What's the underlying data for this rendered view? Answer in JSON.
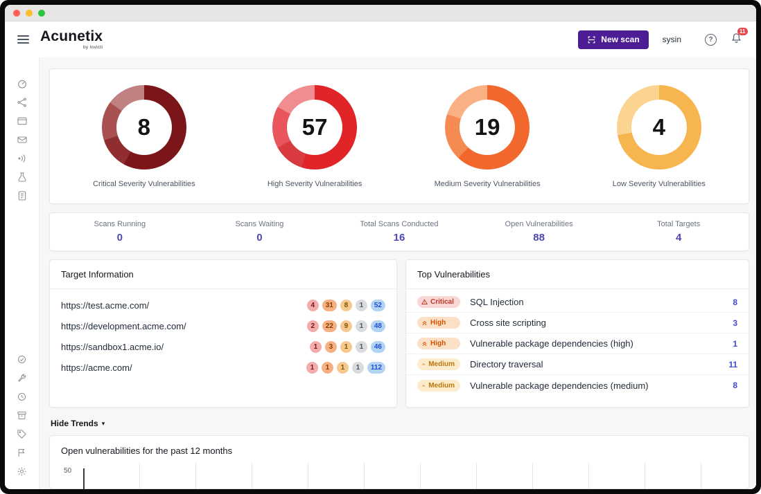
{
  "titlebar": {
    "controls": [
      "close",
      "minimize",
      "zoom"
    ]
  },
  "header": {
    "logo": "Acunetix",
    "logo_sub": "by Invicti",
    "new_scan_label": "New scan",
    "username": "sysin",
    "help_glyph": "?",
    "notification_count": "11"
  },
  "sidebar": {
    "top_icons": [
      "dashboard",
      "discovery",
      "targets",
      "vulnerabilities",
      "scans",
      "labs",
      "reports"
    ],
    "bottom_icons": [
      "status",
      "tools",
      "history",
      "archive",
      "tags",
      "flags",
      "settings"
    ]
  },
  "donuts": [
    {
      "value": "8",
      "label": "Critical Severity Vulnerabilities",
      "segments": [
        {
          "color": "#7a1619",
          "pct": 58
        },
        {
          "color": "#8f2d30",
          "pct": 12
        },
        {
          "color": "#a85052",
          "pct": 15
        },
        {
          "color": "#c08183",
          "pct": 15
        }
      ]
    },
    {
      "value": "57",
      "label": "High Severity Vulnerabilities",
      "segments": [
        {
          "color": "#e02428",
          "pct": 55
        },
        {
          "color": "#d93a3f",
          "pct": 12
        },
        {
          "color": "#e8555a",
          "pct": 16
        },
        {
          "color": "#f08d90",
          "pct": 17
        }
      ]
    },
    {
      "value": "19",
      "label": "Medium Severity Vulnerabilities",
      "segments": [
        {
          "color": "#f2682c",
          "pct": 62
        },
        {
          "color": "#f58a52",
          "pct": 18
        },
        {
          "color": "#f9b183",
          "pct": 20
        }
      ]
    },
    {
      "value": "4",
      "label": "Low Severity Vulnerabilities",
      "segments": [
        {
          "color": "#f7b54f",
          "pct": 72
        },
        {
          "color": "#fbd492",
          "pct": 28
        }
      ]
    }
  ],
  "stats": [
    {
      "label": "Scans Running",
      "value": "0"
    },
    {
      "label": "Scans Waiting",
      "value": "0"
    },
    {
      "label": "Total Scans Conducted",
      "value": "16"
    },
    {
      "label": "Open Vulnerabilities",
      "value": "88"
    },
    {
      "label": "Total Targets",
      "value": "4"
    }
  ],
  "targets": {
    "title": "Target Information",
    "rows": [
      {
        "url": "https://test.acme.com/",
        "badges": [
          "4",
          "31",
          "8",
          "1",
          "52"
        ]
      },
      {
        "url": "https://development.acme.com/",
        "badges": [
          "2",
          "22",
          "9",
          "1",
          "48"
        ]
      },
      {
        "url": "https://sandbox1.acme.io/",
        "badges": [
          "1",
          "3",
          "1",
          "1",
          "46"
        ]
      },
      {
        "url": "https://acme.com/",
        "badges": [
          "1",
          "1",
          "1",
          "1",
          "112"
        ]
      }
    ]
  },
  "top_vulnerabilities": {
    "title": "Top Vulnerabilities",
    "rows": [
      {
        "severity": "Critical",
        "name": "SQL Injection",
        "count": "8"
      },
      {
        "severity": "High",
        "name": "Cross site scripting",
        "count": "3"
      },
      {
        "severity": "High",
        "name": "Vulnerable package dependencies (high)",
        "count": "1"
      },
      {
        "severity": "Medium",
        "name": "Directory traversal",
        "count": "11"
      },
      {
        "severity": "Medium",
        "name": "Vulnerable package dependencies (medium)",
        "count": "8"
      }
    ]
  },
  "trends": {
    "toggle_label": "Hide Trends",
    "caret": "▾",
    "chart_title": "Open vulnerabilities for the past 12 months",
    "y_tick": "50"
  },
  "colors": {
    "brand_purple": "#4c1d95",
    "critical": "#7a1619",
    "high": "#e02428",
    "medium": "#f2682c",
    "low": "#f7b54f",
    "stat_value": "#4c46b6",
    "link_count": "#3f4bd8",
    "notification_badge": "#e5484d"
  }
}
